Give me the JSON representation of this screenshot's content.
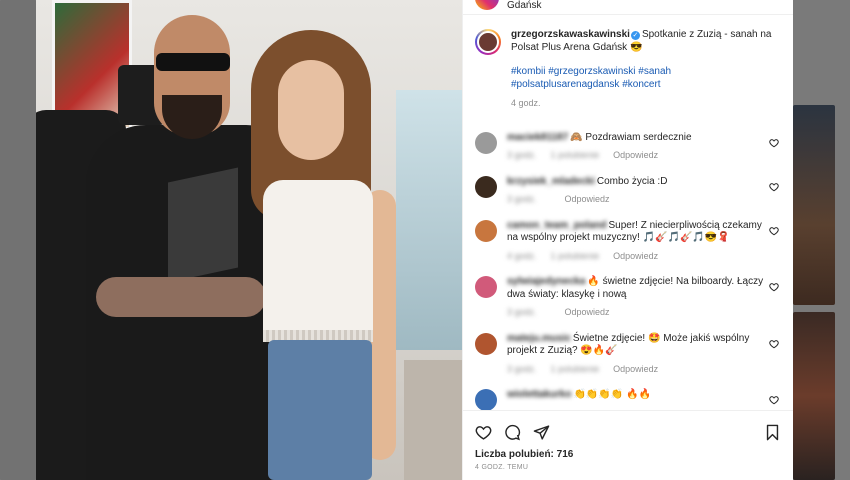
{
  "post": {
    "top_location": "Gdańsk",
    "author": "grzegorzskawaskawinski",
    "caption": "Spotkanie z Zuzią - sanah na Polsat Plus Arena Gdańsk 😎",
    "hashtags": "#kombii #grzegorzskawinski #sanah #polsatplusarenagdansk #koncert",
    "time": "4 godz."
  },
  "comments": [
    {
      "user": "maciek81187",
      "text": "🙈 Pozdrawiam serdecznie",
      "time": "3 godz.",
      "likes": "1 polubienie",
      "reply": "Odpowiedz",
      "avatar_color": "#9a9a9a"
    },
    {
      "user": "krzysiek_mladecki",
      "text": "Combo życia :D",
      "time": "3 godz.",
      "likes": "",
      "reply": "Odpowiedz",
      "avatar_color": "#3a2a1e"
    },
    {
      "user": "camon_team_poland",
      "text": "Super! Z niecierpliwością czekamy na wspólny projekt muzyczny! 🎵🎸🎵🎸🎵😎🧣",
      "time": "4 godz.",
      "likes": "1 polubienie",
      "reply": "Odpowiedz",
      "avatar_color": "#c8763e"
    },
    {
      "user": "sylwiajedynecka",
      "text": "🔥 świetne zdjęcie! Na bilboardy. Łączy dwa światy: klasykę i nową",
      "time": "3 godz.",
      "likes": "",
      "reply": "Odpowiedz",
      "avatar_color": "#d15a7a"
    },
    {
      "user": "mateju.music",
      "text": "Świetne zdjęcie! 🤩 Może jakiś wspólny projekt z Zuzią? 😍🔥🎸",
      "time": "3 godz.",
      "likes": "1 polubienie",
      "reply": "Odpowiedz",
      "avatar_color": "#b0552f"
    },
    {
      "user": "wiolettakurko",
      "text": "👏👏👏👏 🔥🔥",
      "time": "",
      "likes": "",
      "reply": "",
      "avatar_color": "#3b6fb5"
    }
  ],
  "footer": {
    "likes_label": "Liczba polubień: 716",
    "date": "4 GODZ. TEMU"
  },
  "icons": [
    "heart-icon",
    "comment-icon",
    "share-icon",
    "bookmark-icon"
  ]
}
